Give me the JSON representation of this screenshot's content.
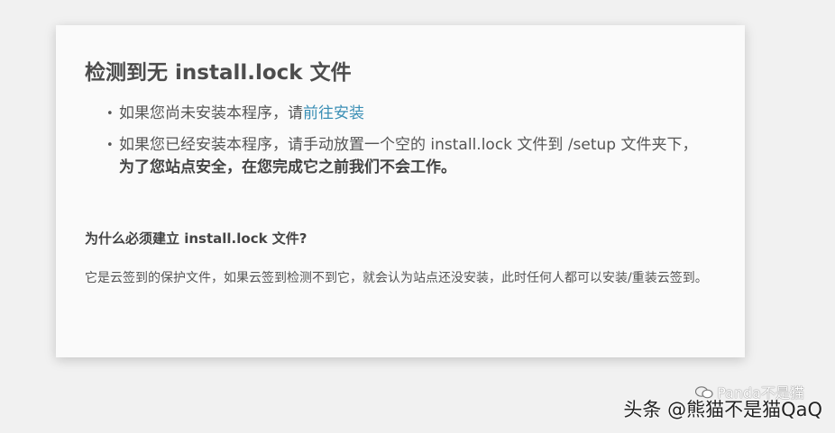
{
  "page": {
    "title": "检测到无 install.lock 文件",
    "tips": [
      {
        "text": "如果您尚未安装本程序，请",
        "link": "前往安装"
      },
      {
        "text": "如果您已经安装本程序，请手动放置一个空的 install.lock 文件到 /setup 文件夹下，",
        "strong": "为了您站点安全，在您完成它之前我们不会工作。"
      }
    ],
    "bullet": "•",
    "why_title": "为什么必须建立 install.lock 文件?",
    "why_text": "它是云签到的保护文件，如果云签到检测不到它，就会认为站点还没安装，此时任何人都可以安装/重装云签到。"
  },
  "watermark": {
    "main": "头条 @熊猫不是猫QaQ",
    "logo_text": "Panda不是猫"
  }
}
